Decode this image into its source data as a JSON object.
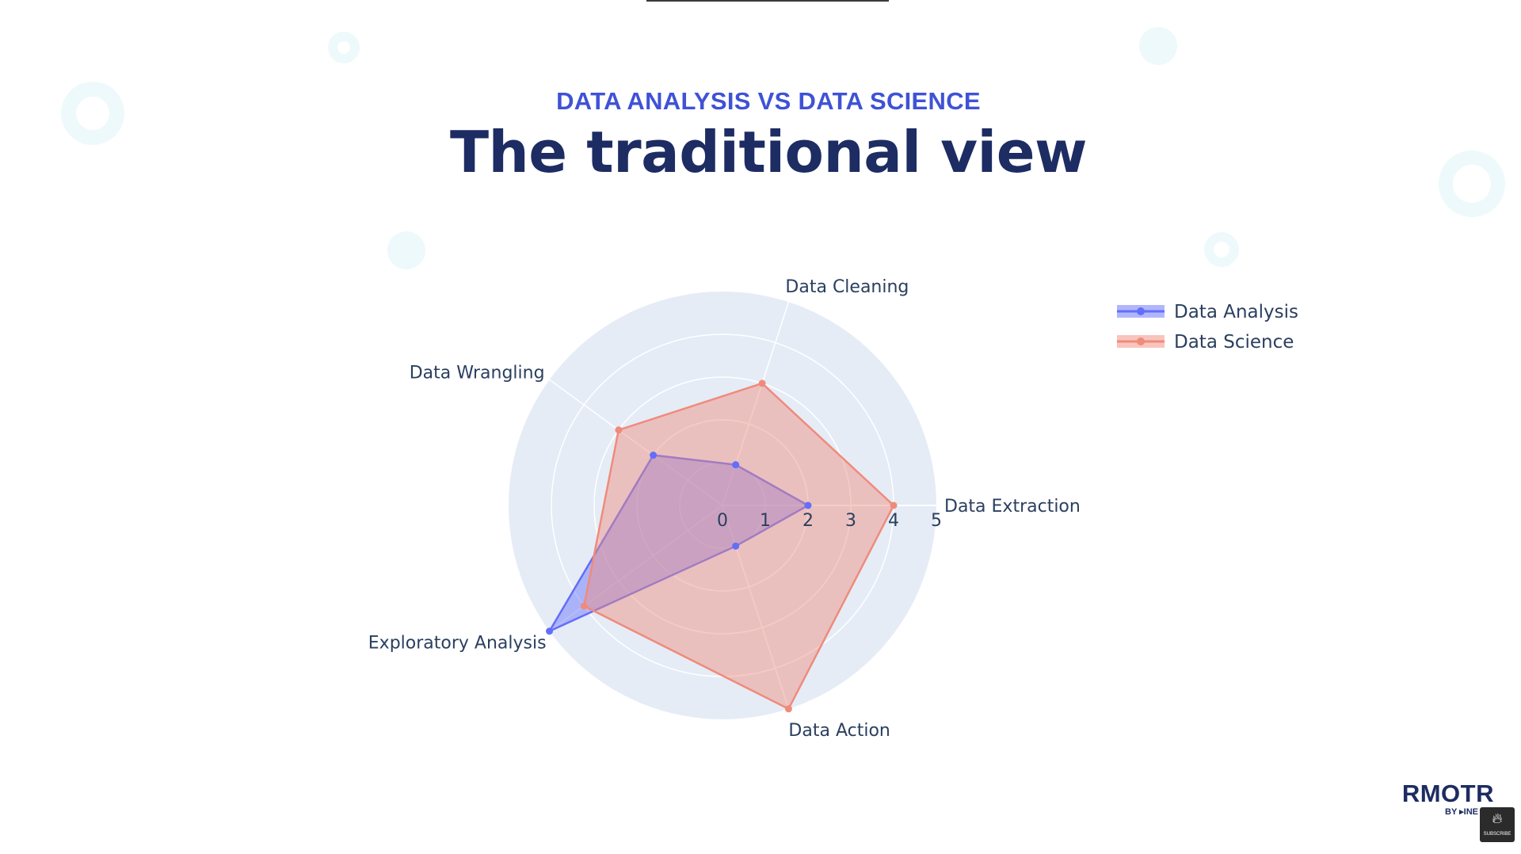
{
  "slide": {
    "kicker": "DATA ANALYSIS VS DATA SCIENCE",
    "title": "The traditional view"
  },
  "chart_data": {
    "type": "radar",
    "axes": [
      "Data Extraction",
      "Data Cleaning",
      "Data Wrangling",
      "Exploratory Analysis",
      "Data Action"
    ],
    "radial_range": [
      0,
      5
    ],
    "radial_ticks": [
      "0",
      "1",
      "2",
      "3",
      "4",
      "5"
    ],
    "series": [
      {
        "name": "Data Analysis",
        "values": [
          2,
          1,
          2,
          5,
          1
        ],
        "color": "#636efa"
      },
      {
        "name": "Data Science",
        "values": [
          4,
          3,
          3,
          4,
          5
        ],
        "color": "#ef8b7c"
      }
    ],
    "legend_position": "top-right",
    "background_color": "#e5ecf6",
    "grid": true
  },
  "logo": {
    "name": "RMOTR",
    "byline": "BY ▸INE"
  },
  "badge": {
    "label": "SUBSCRIBE",
    "icon": "flame-icon"
  }
}
